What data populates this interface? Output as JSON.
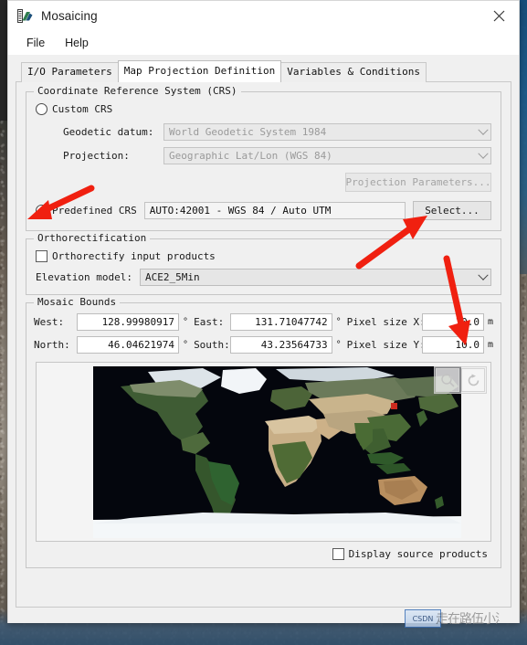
{
  "window": {
    "title": "Mosaicing",
    "icon": "mosaic-app-icon",
    "close_label": "✕"
  },
  "menubar": {
    "items": [
      {
        "label": "File",
        "name": "menu-file"
      },
      {
        "label": "Help",
        "name": "menu-help"
      }
    ]
  },
  "tabs": [
    {
      "label": "I/O Parameters",
      "active": false
    },
    {
      "label": "Map Projection Definition",
      "active": true
    },
    {
      "label": "Variables & Conditions",
      "active": false
    }
  ],
  "crs": {
    "legend": "Coordinate Reference System (CRS)",
    "custom_crs_label": "Custom CRS",
    "custom_crs_selected": false,
    "geodetic_datum_label": "Geodetic datum:",
    "geodetic_datum_value": "World Geodetic System 1984",
    "projection_label": "Projection:",
    "projection_value": "Geographic Lat/Lon (WGS 84)",
    "projection_parameters_label": "Projection Parameters...",
    "projection_parameters_disabled": true,
    "predefined_crs_label": "Predefined CRS",
    "predefined_crs_selected": true,
    "predefined_crs_value": "AUTO:42001 - WGS 84 / Auto UTM",
    "select_button_label": "Select..."
  },
  "ortho": {
    "legend": "Orthorectification",
    "orthorectify_label": "Orthorectify input products",
    "orthorectify_checked": false,
    "elevation_model_label": "Elevation model:",
    "elevation_model_value": "ACE2_5Min"
  },
  "bounds": {
    "legend": "Mosaic Bounds",
    "degree_symbol": "°",
    "meter_unit": "m",
    "fields": [
      {
        "label": "West:",
        "value": "128.99980917",
        "unit": "°"
      },
      {
        "label": "East:",
        "value": "131.71047742",
        "unit": "°"
      },
      {
        "label": "Pixel size X:",
        "value": "10.0",
        "unit": "m"
      },
      {
        "label": "North:",
        "value": "46.04621974",
        "unit": "°"
      },
      {
        "label": "South:",
        "value": "43.23564733",
        "unit": "°"
      },
      {
        "label": "Pixel size Y:",
        "value": "10.0",
        "unit": "m"
      }
    ]
  },
  "map": {
    "name": "world-map-preview",
    "marker_color": "#cc2a1e",
    "tools": [
      {
        "name": "zoom-all-icon",
        "label": "Zoom all",
        "disabled": true
      },
      {
        "name": "refresh-icon",
        "label": "Refresh",
        "disabled": true
      }
    ]
  },
  "footer": {
    "display_source_products_label": "Display source products",
    "display_source_products_checked": false
  },
  "watermark": {
    "badge": "CSDN",
    "text": "走在路伍小洋"
  },
  "annotations": {
    "color": "#f02010",
    "arrows": [
      {
        "name": "arrow-to-predefined-crs-radio",
        "target": "predefined-crs-radio"
      },
      {
        "name": "arrow-to-select-button",
        "target": "select-button"
      },
      {
        "name": "arrow-to-pixel-size-x",
        "target": "pixel-size-x-field"
      }
    ]
  }
}
